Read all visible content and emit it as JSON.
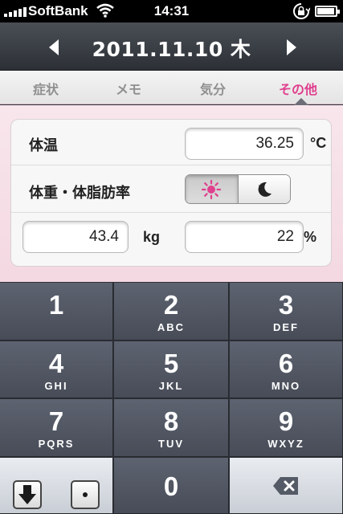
{
  "status_bar": {
    "carrier": "SoftBank",
    "time": "14:31"
  },
  "date_nav": {
    "date": "2011.11.10 木",
    "prev_icon": "triangle-left",
    "next_icon": "triangle-right"
  },
  "tabs": [
    {
      "label": "症状",
      "active": false
    },
    {
      "label": "メモ",
      "active": false
    },
    {
      "label": "気分",
      "active": false
    },
    {
      "label": "その他",
      "active": true
    }
  ],
  "form": {
    "temperature": {
      "label": "体温",
      "value": "36.25",
      "unit": "°C"
    },
    "weight_fat": {
      "label": "体重・体脂肪率",
      "toggle": {
        "selected": "sun",
        "options": [
          "sun-icon",
          "moon-icon"
        ]
      },
      "weight": {
        "value": "43.4",
        "unit": "kg"
      },
      "fat": {
        "value": "22",
        "unit": "%"
      }
    }
  },
  "keypad": {
    "keys": [
      {
        "num": "1",
        "letters": ""
      },
      {
        "num": "2",
        "letters": "ABC"
      },
      {
        "num": "3",
        "letters": "DEF"
      },
      {
        "num": "4",
        "letters": "GHI"
      },
      {
        "num": "5",
        "letters": "JKL"
      },
      {
        "num": "6",
        "letters": "MNO"
      },
      {
        "num": "7",
        "letters": "PQRS"
      },
      {
        "num": "8",
        "letters": "TUV"
      },
      {
        "num": "9",
        "letters": "WXYZ"
      },
      {
        "num": "0",
        "letters": ""
      }
    ]
  },
  "colors": {
    "accent": "#e0408e",
    "nav_bg": "#3a3e45",
    "content_bg": "#f6dde6",
    "key_bg": "#515663"
  }
}
